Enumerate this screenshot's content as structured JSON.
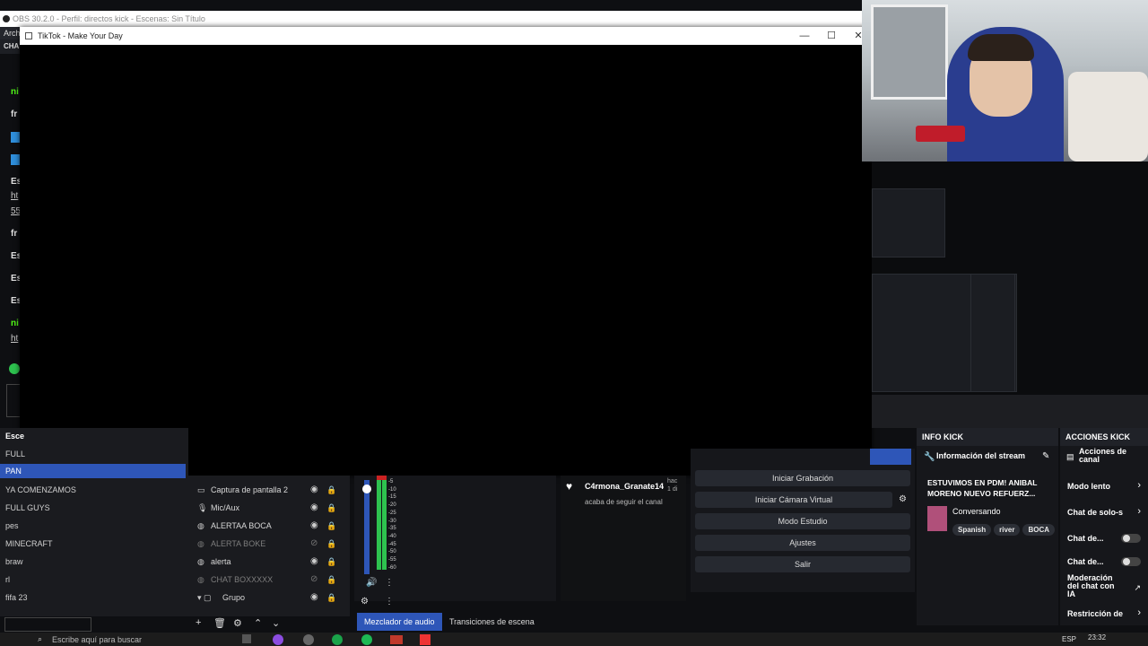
{
  "obs": {
    "title_bar": "OBS 30.2.0 - Perfil: directos kick - Escenas: Sin Título",
    "menu_first": "Arch",
    "chat_label": "CHA"
  },
  "chat_letters": [
    "ni",
    "fr",
    "Es",
    "ht",
    "55",
    "fr",
    "Es",
    "Es",
    "Es",
    "ni",
    "ht"
  ],
  "tiktok": {
    "title": "TikTok - Make Your Day",
    "minimize": "—",
    "maximize": "☐",
    "close": "✕"
  },
  "scenes": {
    "header": "Esce",
    "active": "PAN",
    "first_cut": "FULL",
    "items": [
      "YA COMENZAMOS",
      "FULL GUYS",
      "pes",
      "MINECRAFT",
      "braw",
      "rl",
      "fifa 23"
    ]
  },
  "sources": {
    "items": [
      {
        "label": "Captura de pantalla 2",
        "icon": "monitor-icon",
        "dim": false
      },
      {
        "label": "Mic/Aux",
        "icon": "mic-icon",
        "dim": false
      },
      {
        "label": "ALERTAA BOCA",
        "icon": "globe-icon",
        "dim": false
      },
      {
        "label": "ALERTA BOKE",
        "icon": "globe-icon",
        "dim": true
      },
      {
        "label": "alerta",
        "icon": "globe-icon",
        "dim": false
      },
      {
        "label": "CHAT BOXXXXX",
        "icon": "globe-icon",
        "dim": true
      },
      {
        "label": "Grupo",
        "icon": "folder-icon",
        "dim": false
      }
    ]
  },
  "mixer": {
    "scale": [
      "-5",
      "-10",
      "-15",
      "-20",
      "-25",
      "-30",
      "-35",
      "-40",
      "-45",
      "-50",
      "-55",
      "-60"
    ],
    "tab_mixer": "Mezclador de audio",
    "tab_transitions": "Transiciones de escena"
  },
  "events": {
    "user": "C4rmona_Granate14",
    "time": "hac",
    "time2": "1 di",
    "action": "acaba de seguir el canal"
  },
  "controls": {
    "buttons": [
      "Iniciar Grabación",
      "Iniciar Cámara Virtual",
      "Modo Estudio",
      "Ajustes",
      "Salir"
    ]
  },
  "info_kick": {
    "header": "INFO KICK",
    "section": "Información del stream",
    "stream_title": "ESTUVIMOS EN PDM! ANIBAL MORENO NUEVO REFUERZ...",
    "category": "Conversando",
    "tags": [
      "Spanish",
      "river",
      "BOCA"
    ]
  },
  "acciones_kick": {
    "header": "ACCIONES KICK",
    "section": "Acciones de canal",
    "items": [
      "Modo lento",
      "Chat de solo-s",
      "Chat de...",
      "Chat de...",
      "Moderación del chat con IA",
      "Restricción de"
    ]
  },
  "taskbar": {
    "search": "Escribe aquí para buscar",
    "lang": "ESP",
    "time": "23:32"
  },
  "colors": {
    "accent": "#2e56b8",
    "meter_green": "#2ec24f",
    "kick_green": "#53fc18"
  }
}
